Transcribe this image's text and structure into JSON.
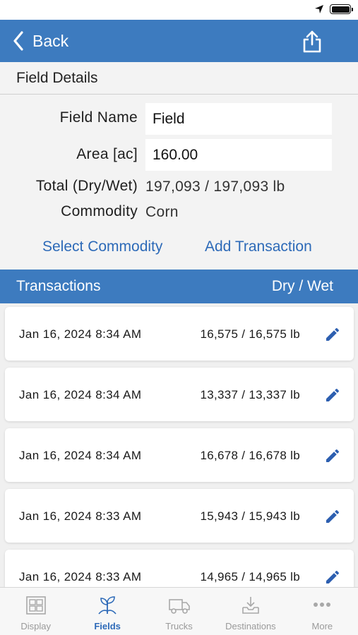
{
  "colors": {
    "accent": "#3d7bbf",
    "link": "#2d6ab8",
    "background": "#f3f3f3",
    "tab_inactive": "#9a9a9a"
  },
  "nav": {
    "back_label": "Back",
    "back_icon": "chevron-left-icon",
    "share_icon": "share-icon"
  },
  "section": {
    "title": "Field Details"
  },
  "details": {
    "field_name_label": "Field Name",
    "field_name_value": "Field",
    "area_label": "Area [ac]",
    "area_value": "160.00",
    "total_label": "Total (Dry/Wet)",
    "total_value": "197,093 / 197,093 lb",
    "commodity_label": "Commodity",
    "commodity_value": "Corn",
    "select_commodity": "Select Commodity",
    "add_transaction": "Add Transaction"
  },
  "transactions": {
    "header_left": "Transactions",
    "header_right": "Dry / Wet",
    "items": [
      {
        "date": "Jan 16, 2024 8:34 AM",
        "amount": "16,575 / 16,575 lb"
      },
      {
        "date": "Jan 16, 2024 8:34 AM",
        "amount": "13,337 / 13,337 lb"
      },
      {
        "date": "Jan 16, 2024 8:34 AM",
        "amount": "16,678 / 16,678 lb"
      },
      {
        "date": "Jan 16, 2024 8:33 AM",
        "amount": "15,943 / 15,943 lb"
      },
      {
        "date": "Jan 16, 2024 8:33 AM",
        "amount": "14,965 / 14,965 lb"
      }
    ]
  },
  "tabs": [
    {
      "label": "Display",
      "icon": "display-grid-icon",
      "active": false
    },
    {
      "label": "Fields",
      "icon": "plant-sprout-icon",
      "active": true
    },
    {
      "label": "Trucks",
      "icon": "truck-icon",
      "active": false
    },
    {
      "label": "Destinations",
      "icon": "download-tray-icon",
      "active": false
    },
    {
      "label": "More",
      "icon": "ellipsis-icon",
      "active": false
    }
  ]
}
